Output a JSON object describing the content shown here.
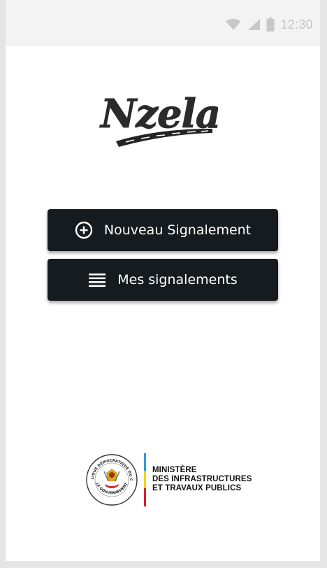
{
  "status_bar": {
    "time": "12:30",
    "icons": [
      "wifi-icon",
      "signal-icon",
      "battery-icon"
    ]
  },
  "app": {
    "logo_text": "Nzela"
  },
  "buttons": {
    "new_report": {
      "label": "Nouveau Signalement",
      "icon": "plus-circle-icon"
    },
    "my_reports": {
      "label": "Mes signalements",
      "icon": "list-icon"
    }
  },
  "footer": {
    "seal_top_text": "RÉPUBLIQUE DÉMOCRATIQUE DU CONGO",
    "seal_bottom_text": "LE GOUVERNEMENT",
    "ministry_line1": "MINISTÈRE",
    "ministry_line2": "DES INFRASTRUCTURES",
    "ministry_line3": "ET TRAVAUX PUBLICS"
  },
  "colors": {
    "button_bg": "#161b1f",
    "button_text": "#ffffff",
    "status_bar_bg": "#f3f3f3",
    "flag_blue": "#2a9fd8",
    "flag_yellow": "#f7d11e",
    "flag_red": "#d3202a"
  }
}
